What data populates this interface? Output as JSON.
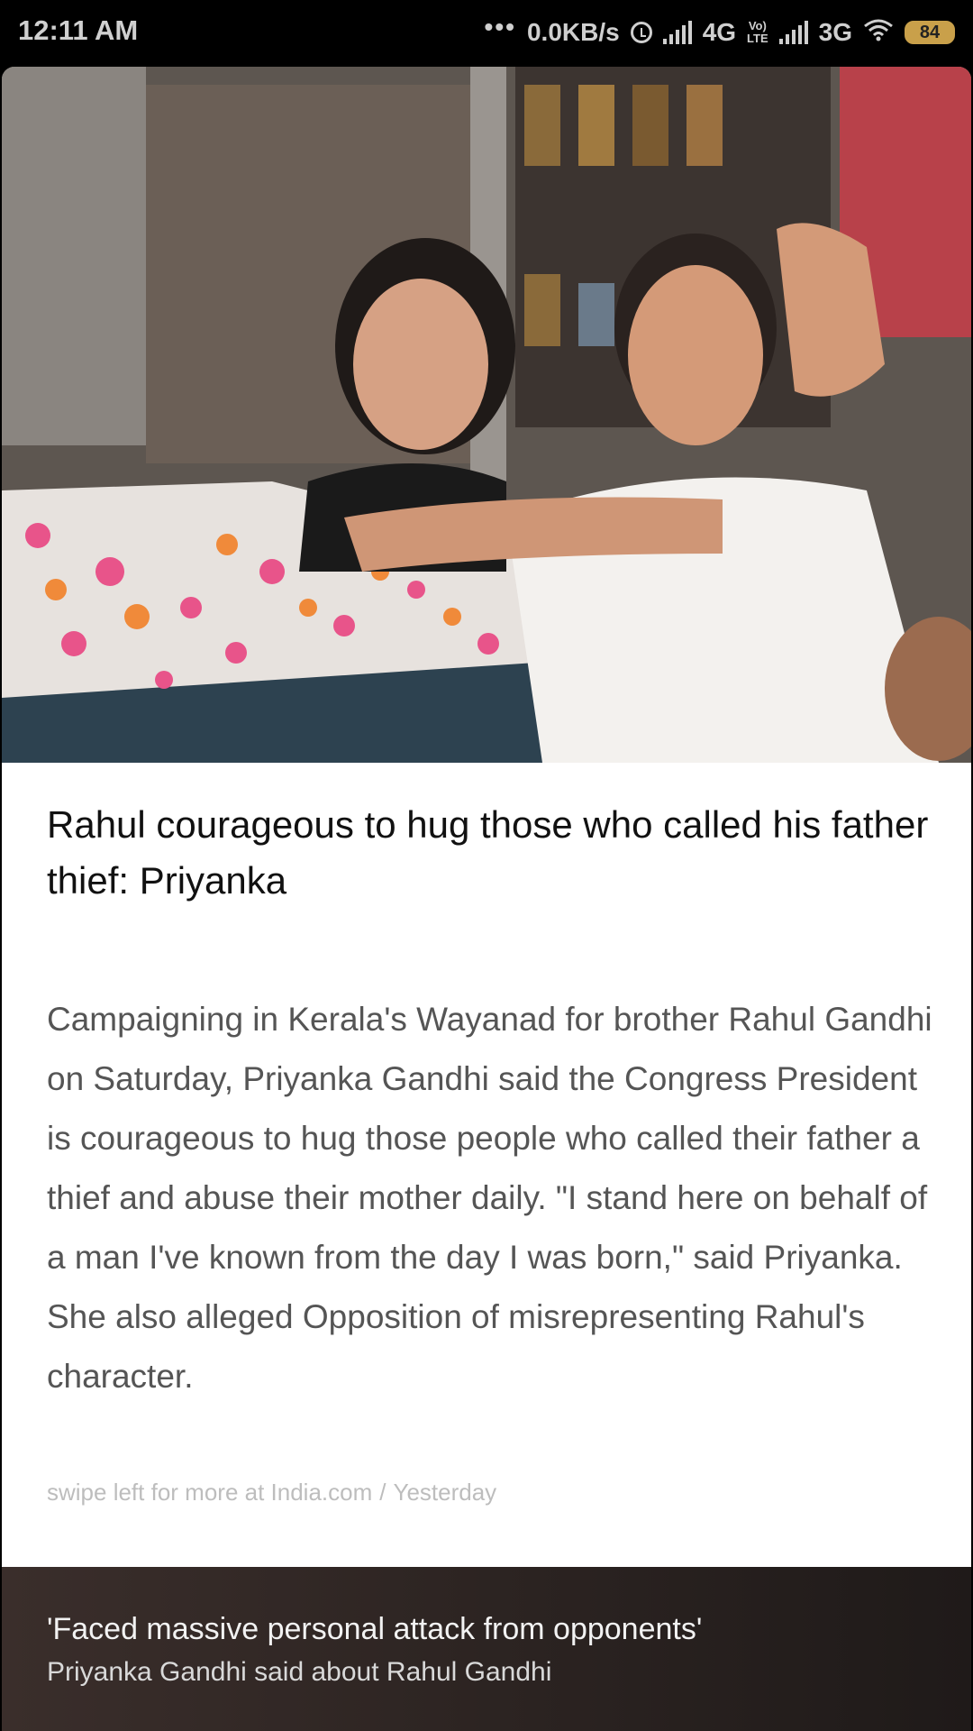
{
  "status_bar": {
    "time": "12:11 AM",
    "more": "•••",
    "net_speed": "0.0KB/s",
    "net1": "4G",
    "volte_top": "Vo)",
    "volte_bottom": "LTE",
    "net2": "3G",
    "battery": "84",
    "colors": {
      "battery": "#c9a04a"
    }
  },
  "article": {
    "headline": "Rahul courageous to hug those who called his father thief: Priyanka",
    "body": "Campaigning in Kerala's Wayanad for brother Rahul Gandhi on Saturday, Priyanka Gandhi said the Congress President is courageous to hug those people who called their father a thief and abuse their mother daily. \"I stand here on behalf of a man I've known from the day I was born,\" said Priyanka. She also alleged Opposition of misrepresenting Rahul's character.",
    "source_prefix": "swipe left for more at India.com",
    "separator": "/",
    "time": "Yesterday"
  },
  "footer": {
    "title": "'Faced massive personal attack from opponents'",
    "subtitle": "Priyanka Gandhi said about Rahul Gandhi"
  }
}
